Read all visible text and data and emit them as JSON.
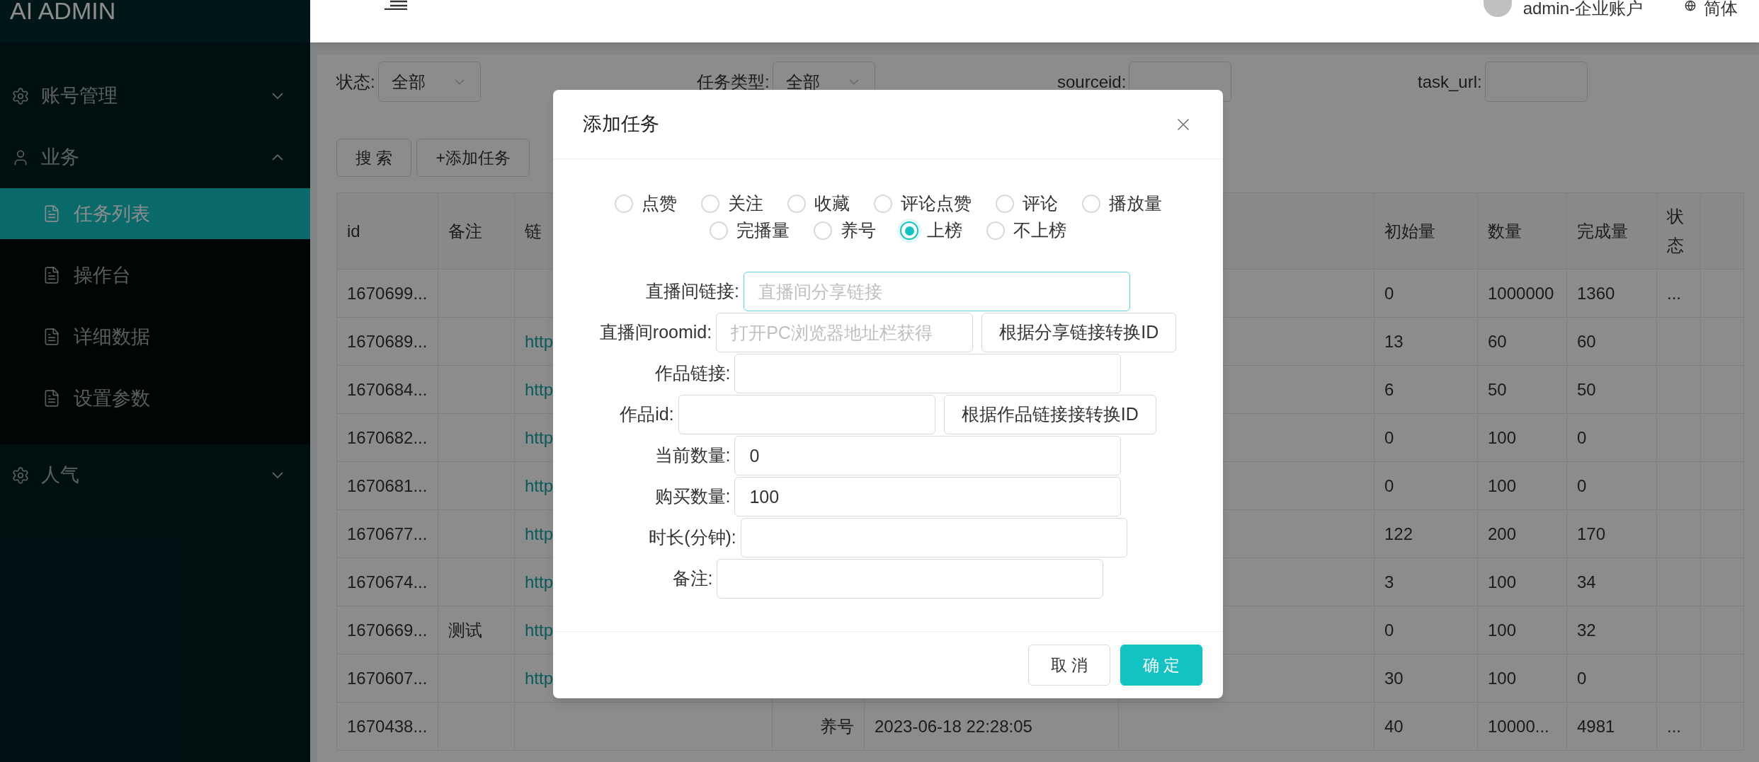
{
  "sidebar": {
    "title": "AI ADMIN",
    "menu": [
      {
        "label": "账号管理",
        "expanded": false
      },
      {
        "label": "业务",
        "expanded": true,
        "children": [
          {
            "label": "任务列表",
            "selected": true
          },
          {
            "label": "操作台",
            "selected": false
          },
          {
            "label": "详细数据",
            "selected": false
          },
          {
            "label": "设置参数",
            "selected": false
          }
        ]
      },
      {
        "label": "人气",
        "expanded": false
      }
    ]
  },
  "header": {
    "user": "admin-企业账户",
    "language": "简体"
  },
  "filters": [
    {
      "label": "状态:",
      "kind": "select",
      "value": "全部"
    },
    {
      "label": "任务类型:",
      "kind": "select",
      "value": "全部"
    },
    {
      "label": "sourceid:",
      "kind": "input"
    },
    {
      "label": "task_url:",
      "kind": "input"
    }
  ],
  "actions": [
    "搜 索",
    "+添加任务"
  ],
  "table": {
    "left_columns": [
      "id",
      "备注",
      "链"
    ],
    "right_columns": [
      "初始量",
      "数量",
      "完成量",
      "状态"
    ],
    "rows": [
      {
        "id": "1670699...",
        "initial": "0",
        "quantity": "1000000",
        "done": "1360",
        "status": "..."
      },
      {
        "id": "1670689...",
        "link": "http",
        "initial": "13",
        "quantity": "60",
        "done": "60"
      },
      {
        "id": "1670684...",
        "link": "http",
        "initial": "6",
        "quantity": "50",
        "done": "50"
      },
      {
        "id": "1670682...",
        "link": "http",
        "initial": "0",
        "quantity": "100",
        "done": "0"
      },
      {
        "id": "1670681...",
        "link": "http",
        "initial": "0",
        "quantity": "100",
        "done": "0"
      },
      {
        "id": "1670677...",
        "link": "http",
        "initial": "122",
        "quantity": "200",
        "done": "170"
      },
      {
        "id": "1670674...",
        "link": "http",
        "initial": "3",
        "quantity": "100",
        "done": "34"
      },
      {
        "id": "1670669...",
        "note": "测试",
        "link": "http",
        "initial": "0",
        "quantity": "100",
        "done": "32"
      },
      {
        "id": "1670607...",
        "link": "http",
        "initial": "30",
        "quantity": "100",
        "done": "0"
      },
      {
        "id": "1670438...",
        "type": "养号",
        "time": "2023-06-18 22:28:05",
        "initial": "40",
        "quantity": "10000...",
        "done": "4981",
        "status": "..."
      }
    ]
  },
  "dialog": {
    "title": "添加任务",
    "task_types": [
      {
        "label": "点赞",
        "selected": false
      },
      {
        "label": "关注",
        "selected": false
      },
      {
        "label": "收藏",
        "selected": false
      },
      {
        "label": "评论点赞",
        "selected": false
      },
      {
        "label": "评论",
        "selected": false
      },
      {
        "label": "播放量",
        "selected": false
      },
      {
        "label": "完播量",
        "selected": false
      },
      {
        "label": "养号",
        "selected": false
      },
      {
        "label": "上榜",
        "selected": true
      },
      {
        "label": "不上榜",
        "selected": false
      }
    ],
    "fields": [
      {
        "label": "直播间链接:",
        "placeholder": "直播间分享链接",
        "focused": true
      },
      {
        "label": "直播间roomid:",
        "placeholder": "打开PC浏览器地址栏获得",
        "focused": false,
        "button": "根据分享链接转换ID"
      },
      {
        "label": "作品链接:",
        "focused": false
      },
      {
        "label": "作品id:",
        "focused": false,
        "button": "根据作品链接接转换ID"
      },
      {
        "label": "当前数量:",
        "value": "0",
        "focused": false
      },
      {
        "label": "购买数量:",
        "value": "100",
        "focused": false
      },
      {
        "label": "时长(分钟):",
        "focused": false
      },
      {
        "label": "备注:",
        "focused": false
      }
    ],
    "buttons": [
      {
        "label": "取 消",
        "kind": "default"
      },
      {
        "label": "确 定",
        "kind": "primary"
      }
    ]
  }
}
